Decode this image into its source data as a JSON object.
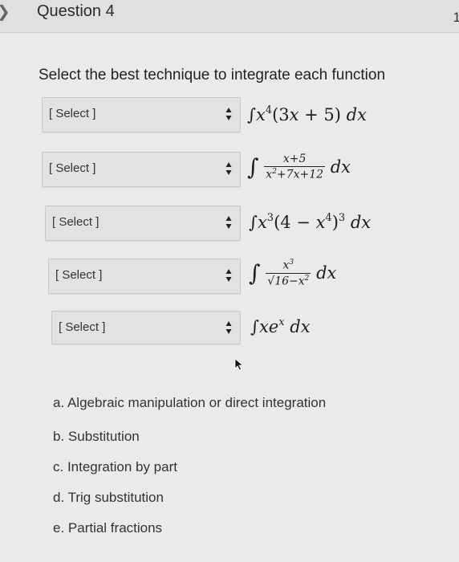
{
  "header": {
    "question_title": "Question 4",
    "points": "1"
  },
  "instructions": "Select the best technique to integrate each function",
  "rows": [
    {
      "select": "[ Select ]"
    },
    {
      "select": "[ Select ]"
    },
    {
      "select": "[ Select ]"
    },
    {
      "select": "[ Select ]"
    },
    {
      "select": "[ Select ]"
    }
  ],
  "options": [
    "a. Algebraic manipulation or direct integration",
    "b. Substitution",
    "c. Integration by part",
    "d. Trig substitution",
    "e. Partial fractions"
  ],
  "colors": {
    "background": "#eceae8",
    "header": "#e2e0de",
    "select_bg": "#e4e2e0"
  }
}
